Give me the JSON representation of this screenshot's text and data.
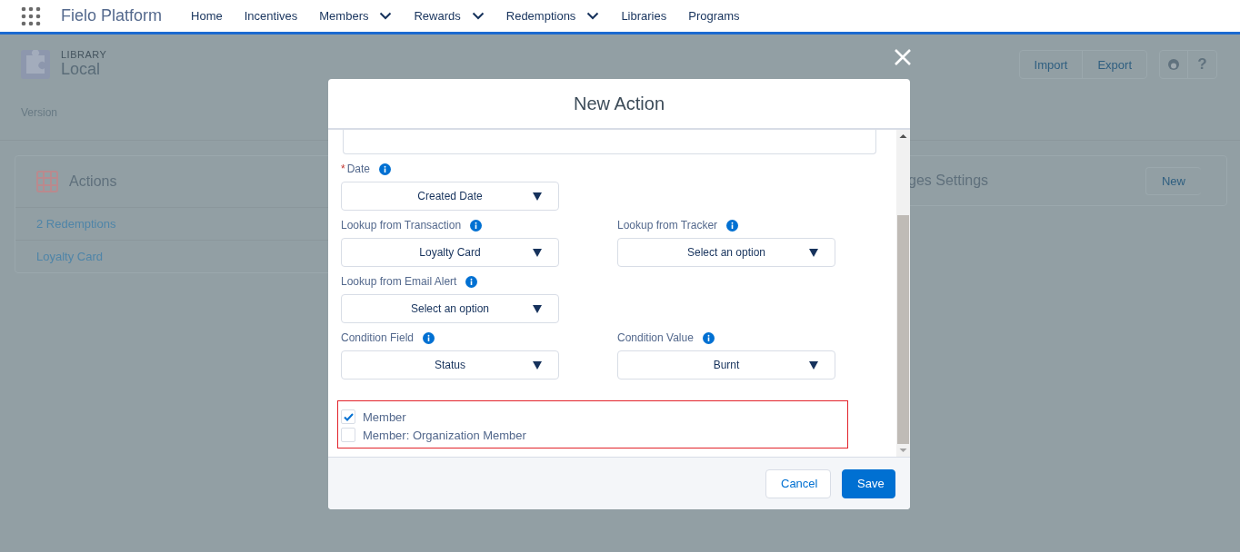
{
  "nav": {
    "app_title": "Fielo Platform",
    "items": [
      {
        "label": "Home",
        "has_menu": false
      },
      {
        "label": "Incentives",
        "has_menu": false
      },
      {
        "label": "Members",
        "has_menu": true
      },
      {
        "label": "Rewards",
        "has_menu": true
      },
      {
        "label": "Redemptions",
        "has_menu": true
      },
      {
        "label": "Libraries",
        "has_menu": false
      },
      {
        "label": "Programs",
        "has_menu": false
      }
    ]
  },
  "page": {
    "eyebrow": "LIBRARY",
    "title": "Local",
    "tab": "Version",
    "buttons": [
      "Import",
      "Export"
    ],
    "help_label": "?"
  },
  "cards": [
    {
      "title": "Actions",
      "rows": [
        "2 Redemptions",
        "Loyalty Card"
      ]
    },
    {
      "title": "ges Settings",
      "button": "New"
    }
  ],
  "modal": {
    "title": "New Action",
    "rows": [
      {
        "fields": [
          {
            "label": "Date",
            "required_mark": "*",
            "value": "Created Date"
          }
        ]
      },
      {
        "fields": [
          {
            "label": "Lookup from Transaction",
            "value": "Loyalty Card"
          },
          {
            "label": "Lookup from Tracker",
            "value": "Select an option"
          }
        ]
      },
      {
        "fields": [
          {
            "label": "Lookup from Email Alert",
            "value": "Select an option"
          }
        ]
      },
      {
        "fields": [
          {
            "label": "Condition Field",
            "value": "Status"
          },
          {
            "label": "Condition Value",
            "value": "Burnt"
          }
        ]
      }
    ],
    "checkboxes": [
      {
        "label": "Member",
        "checked": true
      },
      {
        "label": "Member: Organization Member",
        "checked": false
      }
    ],
    "cancel": "Cancel",
    "save": "Save"
  }
}
